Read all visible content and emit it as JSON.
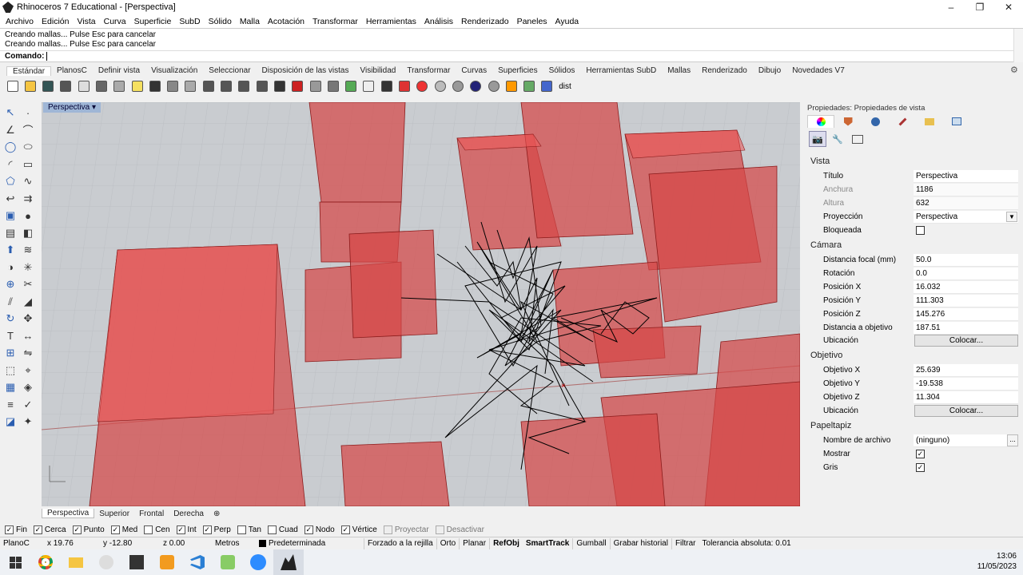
{
  "window": {
    "title": "Rhinoceros 7 Educational - [Perspectiva]",
    "min": "–",
    "max": "❐",
    "close": "✕"
  },
  "menu": [
    "Archivo",
    "Edición",
    "Vista",
    "Curva",
    "Superficie",
    "SubD",
    "Sólido",
    "Malla",
    "Acotación",
    "Transformar",
    "Herramientas",
    "Análisis",
    "Renderizado",
    "Paneles",
    "Ayuda"
  ],
  "command": {
    "history": [
      "Creando mallas... Pulse Esc para cancelar",
      "Creando mallas... Pulse Esc para cancelar"
    ],
    "prompt": "Comando:"
  },
  "toolbar_tabs": [
    "Estándar",
    "PlanosC",
    "Definir vista",
    "Visualización",
    "Seleccionar",
    "Disposición de las vistas",
    "Visibilidad",
    "Transformar",
    "Curvas",
    "Superficies",
    "Sólidos",
    "Herramientas SubD",
    "Mallas",
    "Renderizado",
    "Dibujo",
    "Novedades V7"
  ],
  "toolbar_icons": [
    "new-icon",
    "open-icon",
    "save-icon",
    "print-icon",
    "import-icon",
    "cut-icon",
    "copy-icon",
    "paste-icon",
    "undo-icon",
    "pan-icon",
    "move-view-icon",
    "zoom-icon",
    "zoom-window-icon",
    "zoom-extents-icon",
    "zoom-selected-icon",
    "four-views-icon",
    "car-icon",
    "camera-icon",
    "grid-icon",
    "cplane-icon",
    "light-icon",
    "lock-icon",
    "layer-icon",
    "color-wheel-icon",
    "shade-icon",
    "render-icon",
    "sphere-icon",
    "material-icon",
    "dimension-icon",
    "globe-icon",
    "help-icon"
  ],
  "toolbar_extra": "dist",
  "viewport": {
    "label": "Perspectiva",
    "arrow": "▾",
    "tabs": [
      "Perspectiva",
      "Superior",
      "Frontal",
      "Derecha"
    ],
    "add_tab": "⊕"
  },
  "osnaps": [
    {
      "label": "Fin",
      "on": true
    },
    {
      "label": "Cerca",
      "on": true
    },
    {
      "label": "Punto",
      "on": true
    },
    {
      "label": "Med",
      "on": true
    },
    {
      "label": "Cen",
      "on": false
    },
    {
      "label": "Int",
      "on": true
    },
    {
      "label": "Perp",
      "on": true
    },
    {
      "label": "Tan",
      "on": false
    },
    {
      "label": "Cuad",
      "on": false
    },
    {
      "label": "Nodo",
      "on": true
    },
    {
      "label": "Vértice",
      "on": true
    },
    {
      "label": "Proyectar",
      "on": false,
      "disabled": true
    },
    {
      "label": "Desactivar",
      "on": false,
      "disabled": true
    }
  ],
  "status": {
    "cplane": "PlanoC",
    "x": "x 19.76",
    "y": "y -12.80",
    "z": "z 0.00",
    "units": "Metros",
    "layer": "Predeterminada",
    "grid_snap": "Forzado a la rejilla",
    "ortho": "Orto",
    "planar": "Planar",
    "osnap": "RefObj",
    "smarttrack": "SmartTrack",
    "gumball": "Gumball",
    "history": "Grabar historial",
    "filter": "Filtrar",
    "tolerance": "Tolerancia absoluta: 0.01"
  },
  "panel": {
    "header": "Propiedades: Propiedades de vista",
    "sections": {
      "vista": "Vista",
      "camara": "Cámara",
      "objetivo": "Objetivo",
      "papeltapiz": "Papeltapiz"
    },
    "vista": {
      "titulo": {
        "k": "Título",
        "v": "Perspectiva"
      },
      "anchura": {
        "k": "Anchura",
        "v": "1186"
      },
      "altura": {
        "k": "Altura",
        "v": "632"
      },
      "proyeccion": {
        "k": "Proyección",
        "v": "Perspectiva"
      },
      "bloqueada": {
        "k": "Bloqueada",
        "v": false
      }
    },
    "camara": {
      "focal": {
        "k": "Distancia focal (mm)",
        "v": "50.0"
      },
      "rotacion": {
        "k": "Rotación",
        "v": "0.0"
      },
      "px": {
        "k": "Posición X",
        "v": "16.032"
      },
      "py": {
        "k": "Posición Y",
        "v": "111.303"
      },
      "pz": {
        "k": "Posición Z",
        "v": "145.276"
      },
      "dist": {
        "k": "Distancia a objetivo",
        "v": "187.51"
      },
      "ubicacion": {
        "k": "Ubicación",
        "v": "Colocar..."
      }
    },
    "objetivo": {
      "ox": {
        "k": "Objetivo X",
        "v": "25.639"
      },
      "oy": {
        "k": "Objetivo Y",
        "v": "-19.538"
      },
      "oz": {
        "k": "Objetivo Z",
        "v": "11.304"
      },
      "ubicacion": {
        "k": "Ubicación",
        "v": "Colocar..."
      }
    },
    "papeltapiz": {
      "archivo": {
        "k": "Nombre de archivo",
        "v": "(ninguno)"
      },
      "mostrar": {
        "k": "Mostrar",
        "v": true
      },
      "gris": {
        "k": "Gris",
        "v": true
      }
    }
  },
  "taskbar": {
    "time": "13:06",
    "date": "11/05/2023"
  }
}
